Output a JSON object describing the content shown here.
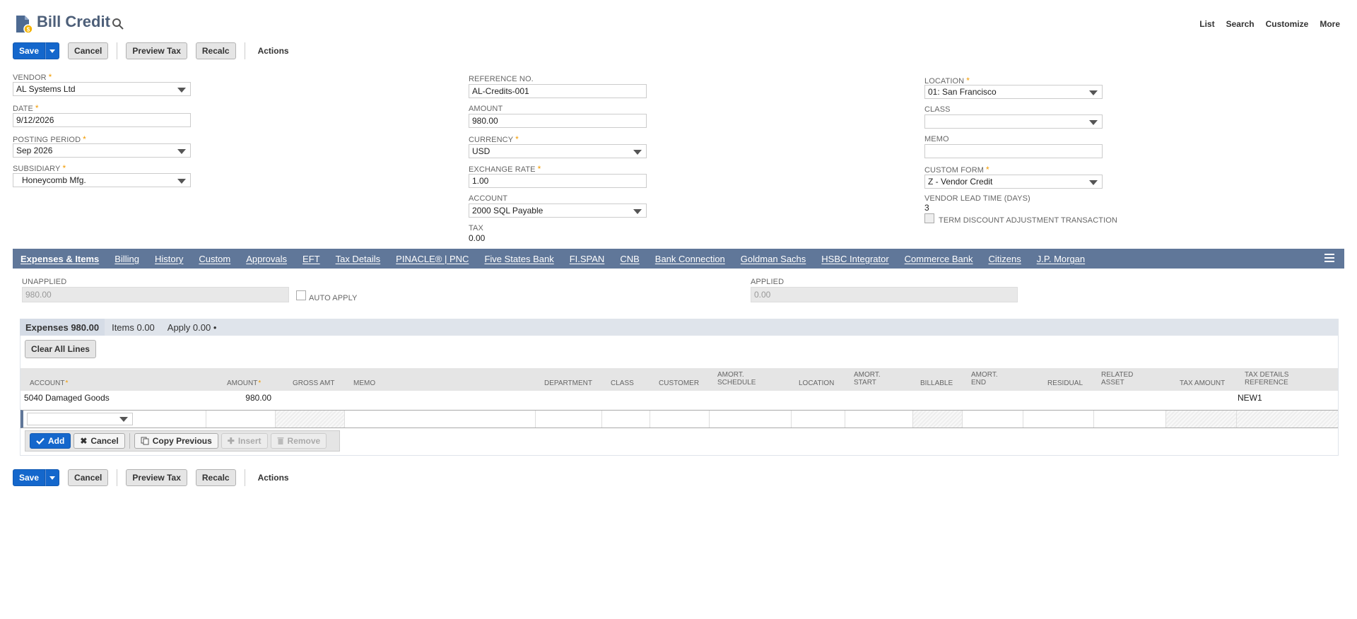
{
  "header": {
    "title": "Bill Credit",
    "links": [
      "List",
      "Search",
      "Customize",
      "More"
    ]
  },
  "toolbar": {
    "save": "Save",
    "cancel": "Cancel",
    "preview_tax": "Preview Tax",
    "recalc": "Recalc",
    "actions": "Actions"
  },
  "fields": {
    "vendor": {
      "label": "VENDOR",
      "value": "AL Systems Ltd"
    },
    "date": {
      "label": "DATE",
      "value": "9/12/2026"
    },
    "posting_period": {
      "label": "POSTING PERIOD",
      "value": "Sep 2026"
    },
    "subsidiary": {
      "label": "SUBSIDIARY",
      "value": "Honeycomb Mfg."
    },
    "reference_no": {
      "label": "REFERENCE NO.",
      "value": "AL-Credits-001"
    },
    "amount": {
      "label": "AMOUNT",
      "value": "980.00"
    },
    "currency": {
      "label": "CURRENCY",
      "value": "USD"
    },
    "exchange_rate": {
      "label": "EXCHANGE RATE",
      "value": "1.00"
    },
    "account": {
      "label": "ACCOUNT",
      "value": "2000 SQL Payable"
    },
    "tax": {
      "label": "TAX",
      "value": "0.00"
    },
    "location": {
      "label": "LOCATION",
      "value": "01: San Francisco"
    },
    "class": {
      "label": "CLASS",
      "value": ""
    },
    "memo": {
      "label": "MEMO",
      "value": ""
    },
    "custom_form": {
      "label": "CUSTOM FORM",
      "value": "Z - Vendor Credit"
    },
    "vendor_lead_time": {
      "label": "VENDOR LEAD TIME (DAYS)",
      "value": "3"
    },
    "term_discount": {
      "label": "TERM DISCOUNT ADJUSTMENT TRANSACTION",
      "checked": false
    }
  },
  "tabs": [
    "Expenses & Items",
    "Billing",
    "History",
    "Custom",
    "Approvals",
    "EFT",
    "Tax Details",
    "PINACLE® | PNC",
    "Five States Bank",
    "FI.SPAN",
    "CNB",
    "Bank Connection",
    "Goldman Sachs",
    "HSBC Integrator",
    "Commerce Bank",
    "Citizens",
    "J.P. Morgan"
  ],
  "apply": {
    "unapplied_label": "UNAPPLIED",
    "unapplied_value": "980.00",
    "auto_apply_label": "AUTO APPLY",
    "applied_label": "APPLIED",
    "applied_value": "0.00"
  },
  "sublist": {
    "subtabs": [
      "Expenses 980.00",
      "Items 0.00",
      "Apply 0.00 •"
    ],
    "clear_all": "Clear All Lines",
    "columns": {
      "account": "ACCOUNT",
      "amount": "AMOUNT",
      "gross_amt": "GROSS AMT",
      "memo": "MEMO",
      "department": "DEPARTMENT",
      "class": "CLASS",
      "customer": "CUSTOMER",
      "amort_schedule_1": "AMORT.",
      "amort_schedule_2": "SCHEDULE",
      "location": "LOCATION",
      "amort_start_1": "AMORT.",
      "amort_start_2": "START",
      "billable": "BILLABLE",
      "amort_end_1": "AMORT.",
      "amort_end_2": "END",
      "residual": "RESIDUAL",
      "related_asset_1": "RELATED",
      "related_asset_2": "ASSET",
      "tax_amount": "TAX AMOUNT",
      "tax_details_ref_1": "TAX DETAILS",
      "tax_details_ref_2": "REFERENCE"
    },
    "rows": [
      {
        "account": "5040 Damaged Goods",
        "amount": "980.00",
        "tax_details_ref": "NEW1"
      }
    ],
    "line_buttons": {
      "add": "Add",
      "cancel": "Cancel",
      "copy_previous": "Copy Previous",
      "insert": "Insert",
      "remove": "Remove"
    }
  },
  "colors": {
    "brand_blue": "#1467cc",
    "tab_bar": "#607799",
    "required_star": "#f29b00",
    "title": "#4d5f79"
  }
}
